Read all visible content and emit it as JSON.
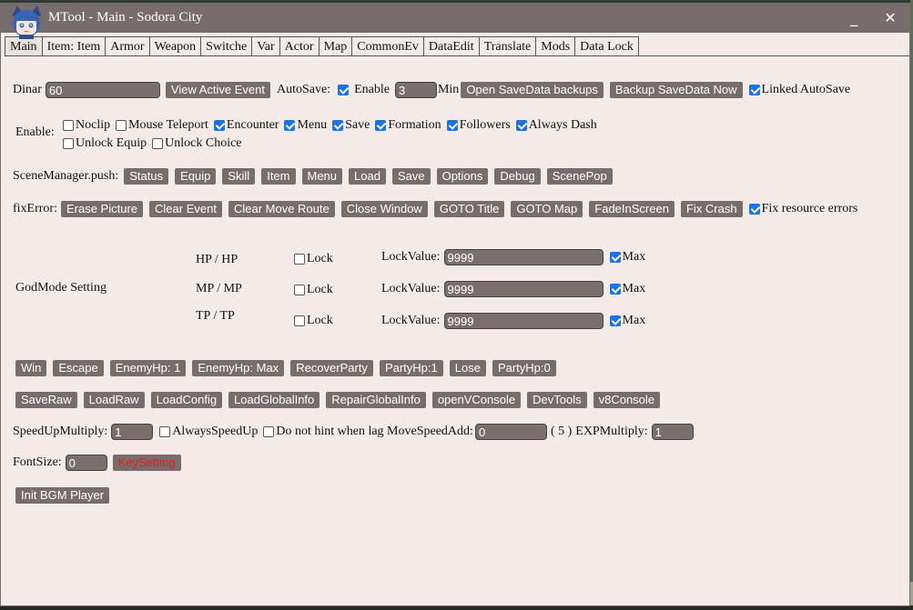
{
  "window": {
    "title": "MTool - Main - Sodora City",
    "minimize": "_",
    "close": "✕"
  },
  "tabs": [
    "Main",
    "Item: Item",
    "Armor",
    "Weapon",
    "Switche",
    "Var",
    "Actor",
    "Map",
    "CommonEv",
    "DataEdit",
    "Translate",
    "Mods",
    "Data Lock"
  ],
  "row1": {
    "dinar_label": "Dinar",
    "dinar_value": "60",
    "view_event": "View Active Event",
    "autosave_label": "AutoSave:",
    "enable_label": "Enable",
    "autosave_value": "3",
    "min_label": "Min",
    "open_backups": "Open SaveData backups",
    "backup_now": "Backup SaveData Now",
    "linked_autosave": "Linked AutoSave"
  },
  "enable": {
    "label": "Enable:",
    "options": [
      {
        "label": "Noclip",
        "checked": false
      },
      {
        "label": "Mouse Teleport",
        "checked": false
      },
      {
        "label": "Encounter",
        "checked": true
      },
      {
        "label": "Menu",
        "checked": true
      },
      {
        "label": "Save",
        "checked": true
      },
      {
        "label": "Formation",
        "checked": true
      },
      {
        "label": "Followers",
        "checked": true
      },
      {
        "label": "Always Dash",
        "checked": true
      }
    ],
    "options2": [
      {
        "label": "Unlock Equip",
        "checked": false
      },
      {
        "label": "Unlock Choice",
        "checked": false
      }
    ]
  },
  "scene": {
    "label": "SceneManager.push:",
    "buttons": [
      "Status",
      "Equip",
      "Skill",
      "Item",
      "Menu",
      "Load",
      "Save",
      "Options",
      "Debug",
      "ScenePop"
    ]
  },
  "fix": {
    "label": "fixError:",
    "buttons": [
      "Erase Picture",
      "Clear Event",
      "Clear Move Route",
      "Close Window",
      "GOTO Title",
      "GOTO Map",
      "FadeInScreen",
      "Fix Crash"
    ],
    "fix_resource": "Fix resource errors"
  },
  "godmode": {
    "label": "GodMode Setting",
    "rows": [
      {
        "stat": "HP / HP",
        "lock": "Lock",
        "lockvalue_label": "LockValue:",
        "value": "9999",
        "max": "Max"
      },
      {
        "stat": "MP / MP",
        "lock": "Lock",
        "lockvalue_label": "LockValue:",
        "value": "9999",
        "max": "Max"
      },
      {
        "stat": "TP / TP",
        "lock": "Lock",
        "lockvalue_label": "LockValue:",
        "value": "9999",
        "max": "Max"
      }
    ]
  },
  "battle": [
    "Win",
    "Escape",
    "EnemyHp: 1",
    "EnemyHp: Max",
    "RecoverParty",
    "PartyHp:1",
    "Lose",
    "PartyHp:0"
  ],
  "tools": [
    "SaveRaw",
    "LoadRaw",
    "LoadConfig",
    "LoadGlobalInfo",
    "RepairGlobalInfo",
    "openVConsole",
    "DevTools",
    "v8Console"
  ],
  "speed": {
    "label": "SpeedUpMultiply:",
    "value": "1",
    "always": "AlwaysSpeedUp",
    "nohint": "Do not hint when lag MoveSpeedAdd:",
    "move_value": "0",
    "move_hint": "( 5 )",
    "exp_label": "EXPMultiply:",
    "exp_value": "1"
  },
  "font": {
    "label": "FontSize:",
    "value": "0",
    "keysetting": "KeySetting"
  },
  "bgm": "Init BGM Player",
  "colors": {
    "titlebar": "#786d6d",
    "panel": "#f4ebe8",
    "button": "#786d6d",
    "check": "#1a73e8",
    "key_text": "#e02020"
  }
}
